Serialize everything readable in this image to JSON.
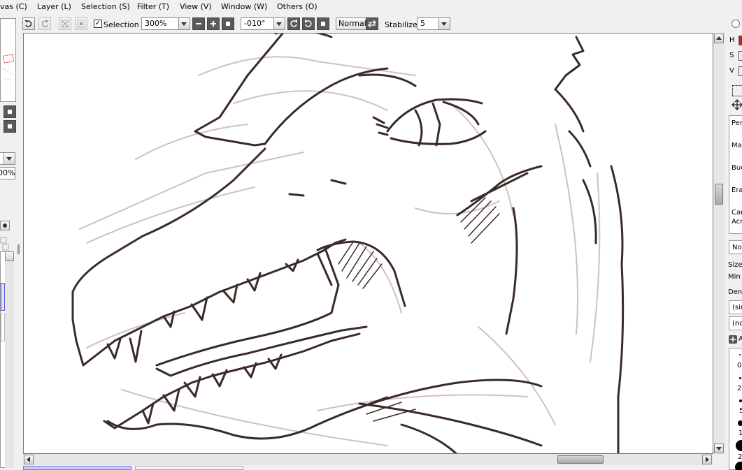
{
  "menubar": {
    "items": [
      {
        "label": "vas (C)"
      },
      {
        "label": "Layer (L)"
      },
      {
        "label": "Selection (S)"
      },
      {
        "label": "Filter (T)"
      },
      {
        "label": "View (V)"
      },
      {
        "label": "Window (W)"
      },
      {
        "label": "Others (O)"
      }
    ]
  },
  "toolbar": {
    "selection_label": "Selection",
    "selection_checked": "✓",
    "zoom_value": "300%",
    "rotation_value": "-010°",
    "blend_mode": "Normal",
    "stabilizer_label": "Stabilizer",
    "stabilizer_value": "5"
  },
  "left_panel": {
    "opacity_value": "00%"
  },
  "right_panel": {
    "hsv": [
      "H",
      "S",
      "V"
    ],
    "tools": [
      "Pen",
      "Mar",
      "Buc",
      "Era",
      "Car",
      "Acr"
    ],
    "blend": "No",
    "size_label": "Size",
    "min_label": "Min",
    "density_label": "Den",
    "shape_value": "(sir",
    "texture_value": "(no",
    "add_label": "A",
    "brush_sizes": [
      "0.",
      "2.",
      "5",
      "1(",
      "2"
    ]
  },
  "canvas": {
    "stroke_color": "#3a2a28",
    "sketch_color": "#c9c4c2"
  }
}
